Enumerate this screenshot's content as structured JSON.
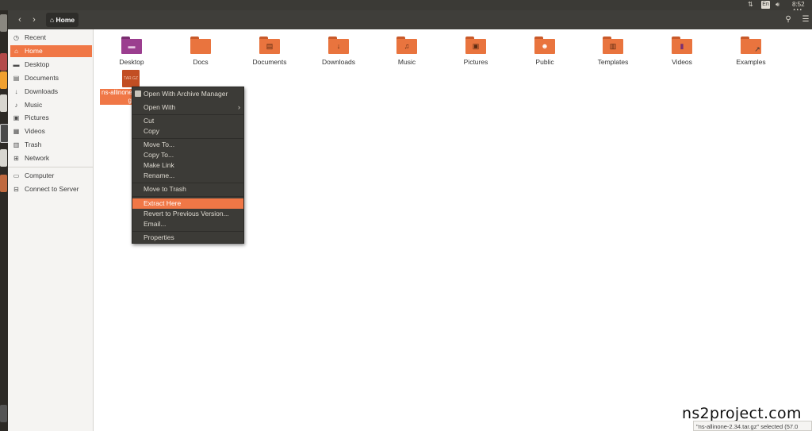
{
  "topbar": {
    "clock": "8:52 AM",
    "lang": "En",
    "network_icon": "network-icon",
    "volume_icon": "volume-icon"
  },
  "header": {
    "back_icon": "back-icon",
    "forward_icon": "forward-icon",
    "path_label": "Home",
    "search_icon": "search-icon",
    "view_icon": "list-view-icon"
  },
  "sidebar": {
    "items": [
      {
        "label": "Recent",
        "icon": "clock-icon"
      },
      {
        "label": "Home",
        "icon": "home-icon",
        "active": true
      },
      {
        "label": "Desktop",
        "icon": "desktop-icon"
      },
      {
        "label": "Documents",
        "icon": "documents-icon"
      },
      {
        "label": "Downloads",
        "icon": "downloads-icon"
      },
      {
        "label": "Music",
        "icon": "music-icon"
      },
      {
        "label": "Pictures",
        "icon": "pictures-icon"
      },
      {
        "label": "Videos",
        "icon": "videos-icon"
      },
      {
        "label": "Trash",
        "icon": "trash-icon"
      },
      {
        "label": "Network",
        "icon": "network-icon"
      },
      {
        "label": "Computer",
        "icon": "computer-icon"
      },
      {
        "label": "Connect to Server",
        "icon": "server-icon"
      }
    ]
  },
  "folders": [
    {
      "label": "Desktop",
      "icon": "desktop-folder-icon"
    },
    {
      "label": "Docs",
      "icon": "folder-icon"
    },
    {
      "label": "Documents",
      "icon": "documents-folder-icon"
    },
    {
      "label": "Downloads",
      "icon": "downloads-folder-icon"
    },
    {
      "label": "Music",
      "icon": "music-folder-icon"
    },
    {
      "label": "Pictures",
      "icon": "pictures-folder-icon"
    },
    {
      "label": "Public",
      "icon": "public-folder-icon"
    },
    {
      "label": "Templates",
      "icon": "templates-folder-icon"
    },
    {
      "label": "Videos",
      "icon": "videos-folder-icon"
    },
    {
      "label": "Examples",
      "icon": "examples-folder-icon"
    }
  ],
  "archive": {
    "line1": "ns-allinone-",
    "line2": "g",
    "icon_text": "TAR.GZ"
  },
  "context_menu": {
    "items": [
      {
        "label": "Open With Archive Manager"
      },
      {
        "label": "Open With"
      },
      {
        "label": "Cut"
      },
      {
        "label": "Copy"
      },
      {
        "label": "Move To..."
      },
      {
        "label": "Copy To..."
      },
      {
        "label": "Make Link"
      },
      {
        "label": "Rename..."
      },
      {
        "label": "Move to Trash"
      },
      {
        "label": "Extract Here",
        "highlighted": true
      },
      {
        "label": "Revert to Previous Version..."
      },
      {
        "label": "Email..."
      },
      {
        "label": "Properties"
      }
    ]
  },
  "status_bar": "\"ns-allinone-2.34.tar.gz\" selected (57.0",
  "watermark": "ns2project.com",
  "colors": {
    "accent": "#f07746",
    "folder_orange": "#e9743e",
    "header_dark": "#3f3e3a",
    "menu_bg": "#3c3b37",
    "desktop_purple": "#9b3e8f"
  }
}
